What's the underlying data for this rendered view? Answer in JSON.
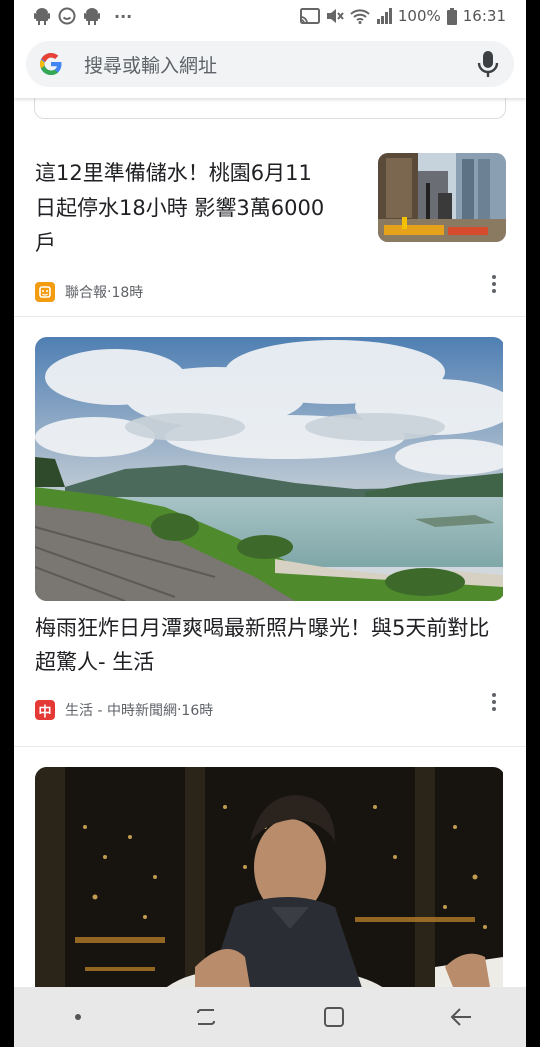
{
  "status_bar": {
    "battery": "100%",
    "time": "16:31",
    "notification_icons": [
      "android-icon",
      "chat-icon",
      "android-icon"
    ],
    "overflow": "···"
  },
  "search": {
    "placeholder": "搜尋或輸入網址"
  },
  "articles": [
    {
      "title": "這12里準備儲水！桃園6月11日起停水18小時 影響3萬6000戶",
      "source": "聯合報",
      "time": "18時",
      "source_icon_color": "#f39c12"
    },
    {
      "title": "梅雨狂炸日月潭爽喝最新照片曝光！與5天前對比超驚人- 生活",
      "source": "生活 - 中時新聞網",
      "time": "16時",
      "source_icon_color": "#e53935",
      "source_icon_glyph": "中"
    }
  ],
  "separator": " · ",
  "colors": {
    "google_blue": "#4285F4",
    "google_red": "#EA4335",
    "google_yellow": "#FBBC05",
    "google_green": "#34A853"
  }
}
